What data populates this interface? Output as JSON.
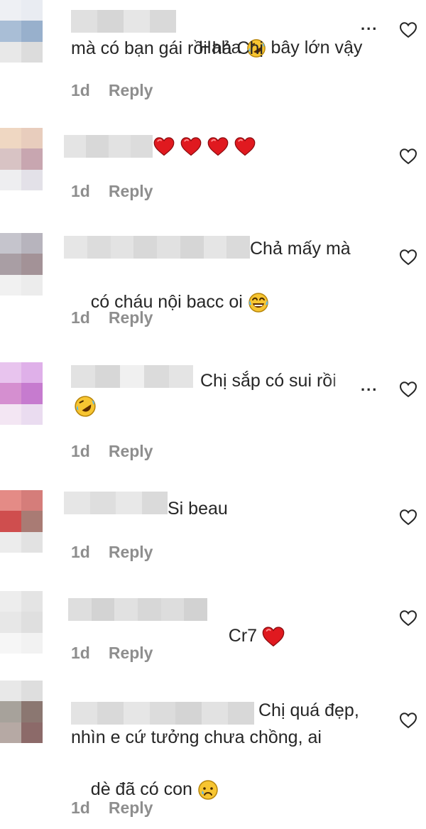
{
  "comments": [
    {
      "id": 1,
      "line1": "Haha ",
      "line1b": " bây lớn vậy",
      "line2": "mà có bạn gái rồi hả Chị",
      "time": "1d",
      "reply": "Reply",
      "more": "...",
      "emoji1": "rolling-laughing-icon"
    },
    {
      "id": 2,
      "time": "1d",
      "reply": "Reply",
      "emoji1": "red-heart-icon"
    },
    {
      "id": 3,
      "line1": "Chả mấy mà",
      "line2": "có cháu nội bacc oi ",
      "time": "1d",
      "reply": "Reply",
      "emoji1": "tears-of-joy-icon"
    },
    {
      "id": 4,
      "line1": "Chị sắp có sui rồi",
      "time": "1d",
      "reply": "Reply",
      "more": "...",
      "emoji1": "rolling-laughing-icon"
    },
    {
      "id": 5,
      "line1": "Si beau",
      "time": "1d",
      "reply": "Reply"
    },
    {
      "id": 6,
      "line1": "Cr7 ",
      "time": "1d",
      "reply": "Reply",
      "emoji1": "red-heart-icon"
    },
    {
      "id": 7,
      "line1": "Chị quá đẹp,",
      "line2": "nhìn e cứ tưởng chưa chồng, ai",
      "line3": "dè đã có con ",
      "time": "1d",
      "reply": "Reply",
      "emoji1": "sad-face-icon"
    }
  ],
  "colors": {
    "text": "#262626",
    "meta": "#8e8e8e",
    "heart": "#e0191f"
  }
}
